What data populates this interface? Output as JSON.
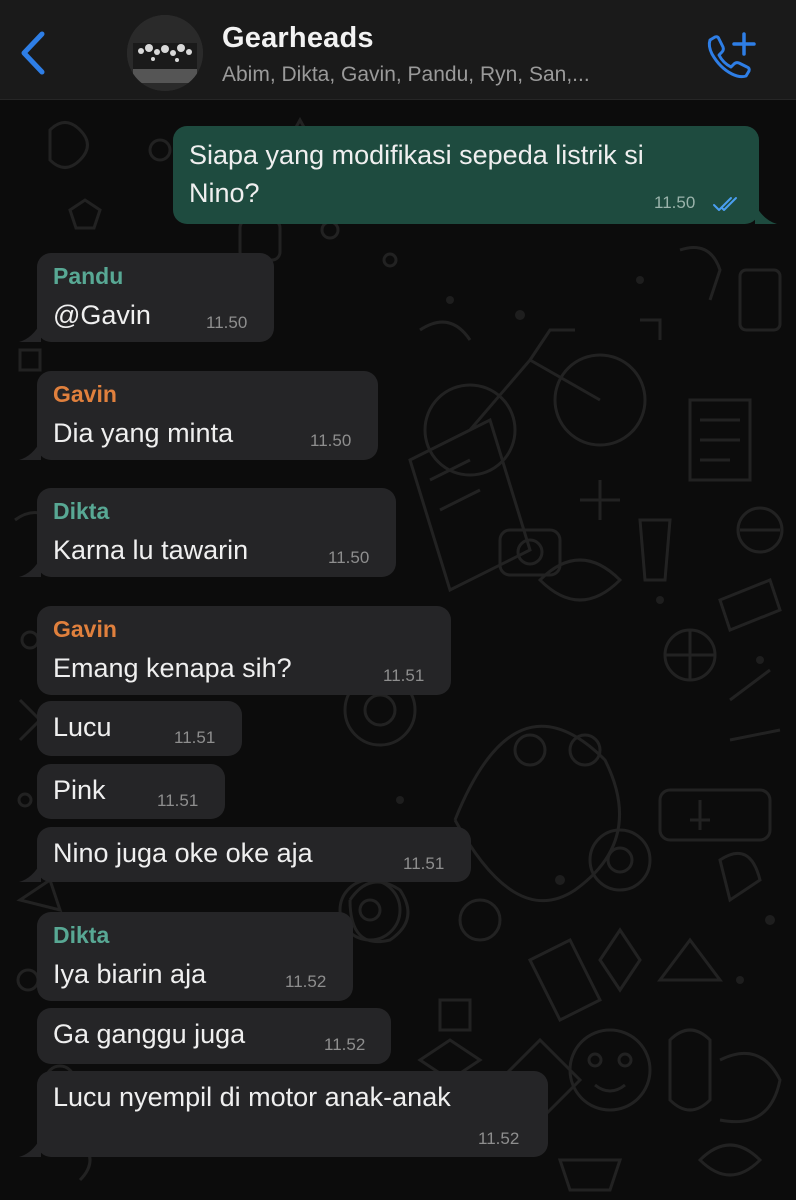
{
  "header": {
    "back_icon": "chevron-left-icon",
    "title": "Gearheads",
    "members": "Abim, Dikta, Gavin, Pandu, Ryn, San,...",
    "call_icon": "add-call-icon"
  },
  "colors": {
    "accent": "#2e7ee6",
    "outgoing_bubble": "#1e4b3f",
    "incoming_bubble": "#252527",
    "sender_pandu": "#58a894",
    "sender_gavin": "#e0803d",
    "sender_dikta": "#58a894"
  },
  "messages": [
    {
      "direction": "out",
      "text1": "Siapa yang modifikasi sepeda listrik si",
      "text2": "Nino?",
      "time": "11.50",
      "status": "read"
    },
    {
      "direction": "in",
      "sender": "Pandu",
      "text": "@Gavin",
      "time": "11.50"
    },
    {
      "direction": "in",
      "sender": "Gavin",
      "text": "Dia yang minta",
      "time": "11.50"
    },
    {
      "direction": "in",
      "sender": "Dikta",
      "text": "Karna lu tawarin",
      "time": "11.50"
    },
    {
      "direction": "in",
      "sender": "Gavin",
      "text": "Emang kenapa sih?",
      "time": "11.51"
    },
    {
      "direction": "in",
      "text": "Lucu",
      "time": "11.51"
    },
    {
      "direction": "in",
      "text": "Pink",
      "time": "11.51"
    },
    {
      "direction": "in",
      "text": "Nino juga oke oke aja",
      "time": "11.51"
    },
    {
      "direction": "in",
      "sender": "Dikta",
      "text": "Iya biarin aja",
      "time": "11.52"
    },
    {
      "direction": "in",
      "text": "Ga ganggu juga",
      "time": "11.52"
    },
    {
      "direction": "in",
      "text": "Lucu nyempil di motor anak-anak",
      "time": "11.52"
    }
  ]
}
